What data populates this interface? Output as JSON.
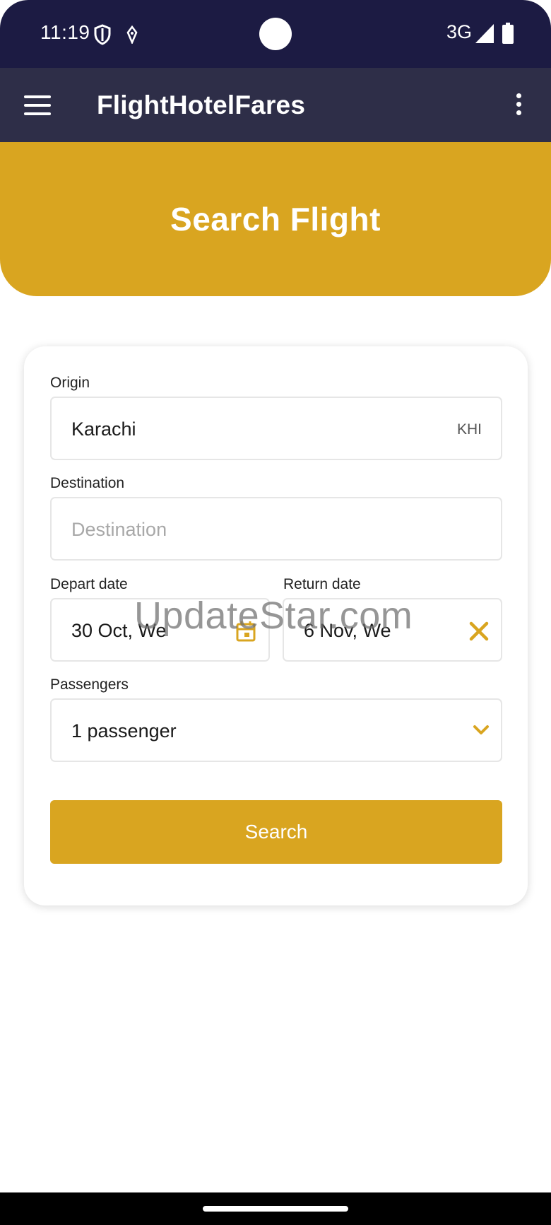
{
  "status_bar": {
    "time": "11:19",
    "network": "3G",
    "icons": [
      "shield-icon",
      "navigation-icon",
      "signal-icon",
      "battery-icon"
    ]
  },
  "app_bar": {
    "title": "FlightHotelFares",
    "icons": [
      "hamburger-menu-icon",
      "more-vert-icon"
    ]
  },
  "hero": {
    "title": "Search Flight"
  },
  "form": {
    "origin": {
      "label": "Origin",
      "value": "Karachi",
      "code": "KHI"
    },
    "destination": {
      "label": "Destination",
      "placeholder": "Destination"
    },
    "depart": {
      "label": "Depart date",
      "value": "30 Oct, We",
      "icon": "calendar-icon"
    },
    "return": {
      "label": "Return date",
      "value": "6 Nov, We",
      "icon": "clear-icon"
    },
    "passengers": {
      "label": "Passengers",
      "value": "1 passenger",
      "icon": "chevron-down-icon"
    },
    "search_label": "Search"
  },
  "watermark": "UpdateStar.com",
  "colors": {
    "status_bar": "#1c1b43",
    "app_bar": "#2e2e48",
    "accent": "#d9a520",
    "border": "#e6e6e6"
  }
}
